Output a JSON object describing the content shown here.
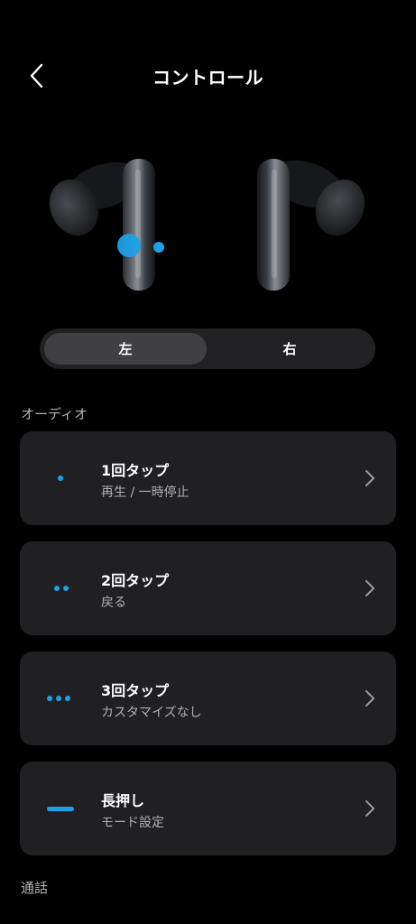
{
  "header": {
    "title": "コントロール",
    "back_icon": "chevron-left-icon"
  },
  "earbuds": {
    "selected_side": "left"
  },
  "side_selector": {
    "left_label": "左",
    "right_label": "右"
  },
  "sections": {
    "audio_label": "オーディオ",
    "call_label": "通話"
  },
  "controls": [
    {
      "label": "1回タップ",
      "value": "再生 / 一時停止",
      "icon": "single-dot-icon"
    },
    {
      "label": "2回タップ",
      "value": "戻る",
      "icon": "double-dot-icon"
    },
    {
      "label": "3回タップ",
      "value": "カスタマイズなし",
      "icon": "triple-dot-icon"
    },
    {
      "label": "長押し",
      "value": "モード設定",
      "icon": "long-press-bar-icon"
    }
  ],
  "colors": {
    "accent": "#1ea0e6",
    "background": "#000000",
    "card": "#202023"
  }
}
